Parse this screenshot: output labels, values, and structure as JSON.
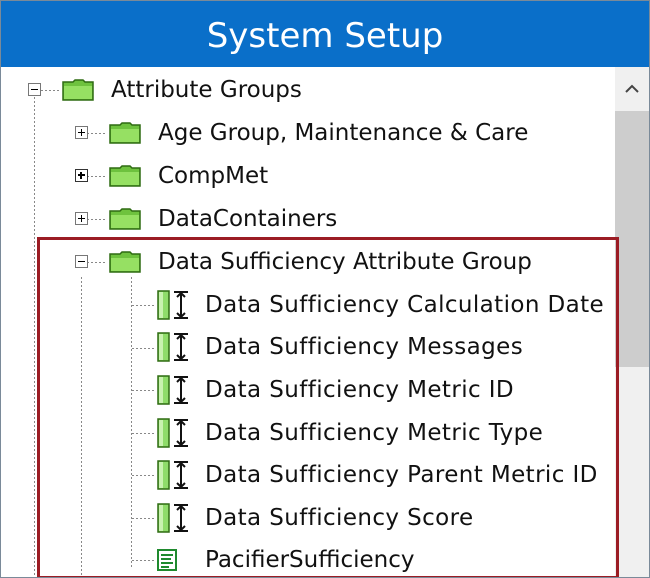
{
  "window": {
    "title": "System Setup"
  },
  "tree": {
    "root": {
      "label": "Attribute Groups"
    },
    "groups": [
      {
        "label": "Age Group, Maintenance & Care"
      },
      {
        "label": "CompMet"
      },
      {
        "label": "DataContainers"
      },
      {
        "label": "Data Sufficiency Attribute Group"
      }
    ],
    "attributes": [
      {
        "label": "Data Sufficiency Calculation Date"
      },
      {
        "label": "Data Sufficiency Messages"
      },
      {
        "label": "Data Sufficiency Metric ID"
      },
      {
        "label": "Data Sufficiency Metric Type"
      },
      {
        "label": "Data Sufficiency Parent Metric ID"
      },
      {
        "label": "Data Sufficiency Score"
      }
    ],
    "table_item": {
      "label": "PacifierSufficiency"
    }
  },
  "colors": {
    "title_bg": "#0a6fc9",
    "highlight_border": "#9b1c24",
    "folder": "#7fd14a",
    "attr_icon": "#8fdc6a"
  }
}
